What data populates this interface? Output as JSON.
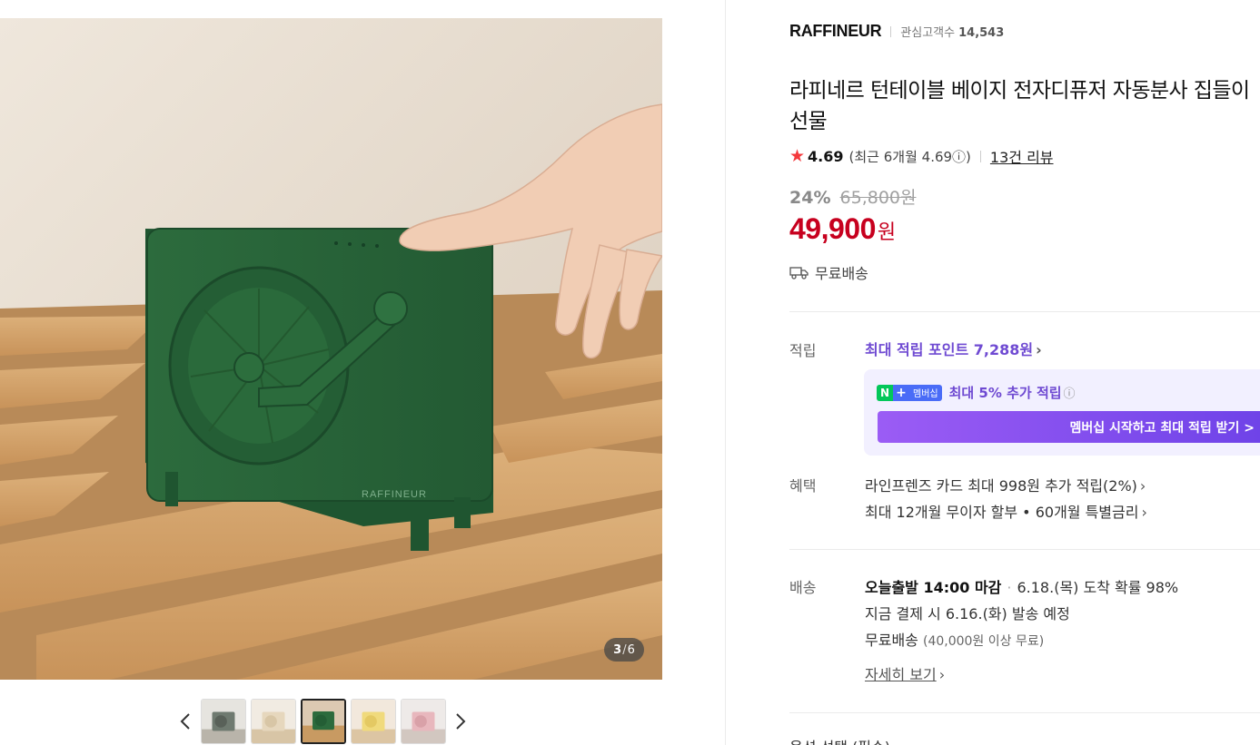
{
  "gallery": {
    "counter_current": "3",
    "counter_sep": "/",
    "counter_total": "6",
    "main_image_icon": "product-photo-green-turntable",
    "prev_icon": "chevron-left-icon",
    "next_icon": "chevron-right-icon",
    "thumbnails": [
      {
        "variant": "gray"
      },
      {
        "variant": "beige"
      },
      {
        "variant": "green",
        "active": true
      },
      {
        "variant": "yellow"
      },
      {
        "variant": "pink"
      }
    ]
  },
  "store": {
    "name": "RAFFINEUR",
    "followers_label": "관심고객수",
    "followers_count": "14,543"
  },
  "product": {
    "title": "라피네르 턴테이블 베이지 전자디퓨저 자동분사 집들이선물",
    "rating": "4.69",
    "recent_rating": "(최근 6개월 4.69ⓘ)",
    "reviews": "13건 리뷰",
    "discount_rate": "24%",
    "original_price": "65,800원",
    "price": "49,900",
    "price_unit": "원",
    "shipping_badge": "무료배송"
  },
  "points": {
    "label": "적립",
    "max_points": "최대 적립 포인트 7,288원",
    "membership_badge_n": "N",
    "membership_badge_plus": "+",
    "membership_badge_text": "멤버십",
    "membership_msg": "최대 5% 추가 적립",
    "membership_btn": "멤버십 시작하고 최대 적립 받기 >"
  },
  "benefits": {
    "label": "혜택",
    "line1": "라인프렌즈 카드 최대 998원 추가 적립(2%)",
    "line2": "최대 12개월 무이자 할부 • 60개월 특별금리"
  },
  "delivery": {
    "label": "배송",
    "cutoff": "오늘출발 14:00 마감",
    "arrival": "6.18.(목) 도착 확률 98%",
    "dispatch": "지금 결제 시 6.16.(화) 발송 예정",
    "free_label": "무료배송",
    "free_condition": "(40,000원 이상 무료)",
    "detail_link": "자세히 보기"
  },
  "next_section": "옵션 선택 (필수)",
  "colors": {
    "accent_purple": "#6f4ad2",
    "price_red": "#c7001e",
    "product_green": "#2e6a3e"
  }
}
